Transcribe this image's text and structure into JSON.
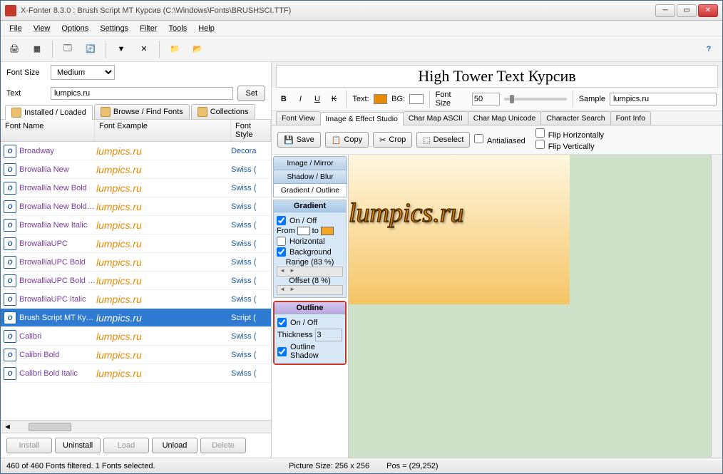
{
  "window": {
    "title": "X-Fonter 8.3.0  :  Brush Script MT Курсив (C:\\Windows\\Fonts\\BRUSHSCI.TTF)"
  },
  "menu": [
    "File",
    "View",
    "Options",
    "Settings",
    "Filter",
    "Tools",
    "Help"
  ],
  "fontsize": {
    "label": "Font Size",
    "value": "Medium"
  },
  "text": {
    "label": "Text",
    "value": "lumpics.ru",
    "set": "Set"
  },
  "lefttabs": {
    "t0": "Installed / Loaded",
    "t1": "Browse / Find Fonts",
    "t2": "Collections"
  },
  "listhead": {
    "name": "Font Name",
    "example": "Font Example",
    "style": "Font Style"
  },
  "fonts": [
    {
      "name": "Broadway",
      "ex": "lumpics.ru",
      "style": "Decora"
    },
    {
      "name": "Browallia New",
      "ex": "lumpics.ru",
      "style": "Swiss ("
    },
    {
      "name": "Browallia New Bold",
      "ex": "lumpics.ru",
      "style": "Swiss ("
    },
    {
      "name": "Browallia New Bold I...",
      "ex": "lumpics.ru",
      "style": "Swiss ("
    },
    {
      "name": "Browallia New Italic",
      "ex": "lumpics.ru",
      "style": "Swiss ("
    },
    {
      "name": "BrowalliaUPC",
      "ex": "lumpics.ru",
      "style": "Swiss ("
    },
    {
      "name": "BrowalliaUPC Bold",
      "ex": "lumpics.ru",
      "style": "Swiss ("
    },
    {
      "name": "BrowalliaUPC Bold It...",
      "ex": "lumpics.ru",
      "style": "Swiss ("
    },
    {
      "name": "BrowalliaUPC Italic",
      "ex": "lumpics.ru",
      "style": "Swiss ("
    },
    {
      "name": "Brush Script MT Кур...",
      "ex": "lumpics.ru",
      "style": "Script (",
      "sel": true
    },
    {
      "name": "Calibri",
      "ex": "lumpics.ru",
      "style": "Swiss ("
    },
    {
      "name": "Calibri Bold",
      "ex": "lumpics.ru",
      "style": "Swiss ("
    },
    {
      "name": "Calibri Bold Italic",
      "ex": "lumpics.ru",
      "style": "Swiss ("
    }
  ],
  "btns": {
    "install": "Install",
    "uninstall": "Uninstall",
    "load": "Load",
    "unload": "Unload",
    "delete": "Delete"
  },
  "preview": {
    "title": "High Tower Text Курсив"
  },
  "format": {
    "text": "Text:",
    "bg": "BG:",
    "fontsize": "Font Size",
    "fsval": "50",
    "sample": "Sample",
    "sampleval": "lumpics.ru"
  },
  "righttabs": [
    "Font View",
    "Image & Effect Studio",
    "Char Map ASCII",
    "Char Map Unicode",
    "Character Search",
    "Font Info"
  ],
  "imgbar": {
    "save": "Save",
    "copy": "Copy",
    "crop": "Crop",
    "deselect": "Deselect",
    "anti": "Antialiased",
    "fliph": "Flip Horizontally",
    "flipv": "Flip Vertically"
  },
  "studiotabs": {
    "t0": "Image / Mirror",
    "t1": "Shadow / Blur",
    "t2": "Gradient / Outline"
  },
  "gradient": {
    "head": "Gradient",
    "onoff": "On / Off",
    "from": "From",
    "to": "to",
    "horiz": "Horizontal",
    "bg": "Background",
    "range": "Range (83 %)",
    "offset": "Offset (8 %)"
  },
  "outline": {
    "head": "Outline",
    "onoff": "On / Off",
    "thick": "Thickness",
    "thickval": "3",
    "shadow": "Outline Shadow"
  },
  "canvastext": "lumpics.ru",
  "status": {
    "left": "460 of 460 Fonts filtered.  1 Fonts selected.",
    "pic": "Picture Size: 256 x 256",
    "pos": "Pos = (29,252)"
  }
}
